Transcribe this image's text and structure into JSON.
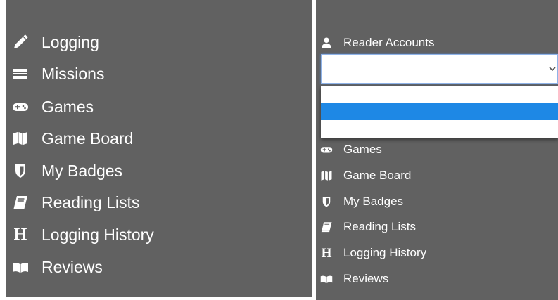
{
  "left_menu": {
    "items": [
      {
        "label": "Logging",
        "icon": "pencil-icon"
      },
      {
        "label": "Missions",
        "icon": "newspaper-icon"
      },
      {
        "label": "Games",
        "icon": "gamepad-icon"
      },
      {
        "label": "Game Board",
        "icon": "map-icon"
      },
      {
        "label": "My Badges",
        "icon": "shield-icon"
      },
      {
        "label": "Reading Lists",
        "icon": "book-icon"
      },
      {
        "label": "Logging History",
        "icon": "h-letter-icon",
        "glyph": "H"
      },
      {
        "label": "Reviews",
        "icon": "open-book-icon"
      }
    ]
  },
  "right_menu": {
    "header": {
      "label": "Reader Accounts",
      "icon": "user-icon"
    },
    "account_select": {
      "value": "",
      "options": [
        "",
        "",
        ""
      ],
      "highlighted_index": 1
    },
    "items": [
      {
        "label": "Games",
        "icon": "gamepad-icon"
      },
      {
        "label": "Game Board",
        "icon": "map-icon"
      },
      {
        "label": "My Badges",
        "icon": "shield-icon"
      },
      {
        "label": "Reading Lists",
        "icon": "book-icon"
      },
      {
        "label": "Logging History",
        "icon": "h-letter-icon",
        "glyph": "H"
      },
      {
        "label": "Reviews",
        "icon": "open-book-icon"
      }
    ]
  },
  "colors": {
    "panel_bg": "#616161",
    "text": "#ffffff",
    "highlight": "#1e88e5",
    "select_border": "#8fb3e8"
  }
}
